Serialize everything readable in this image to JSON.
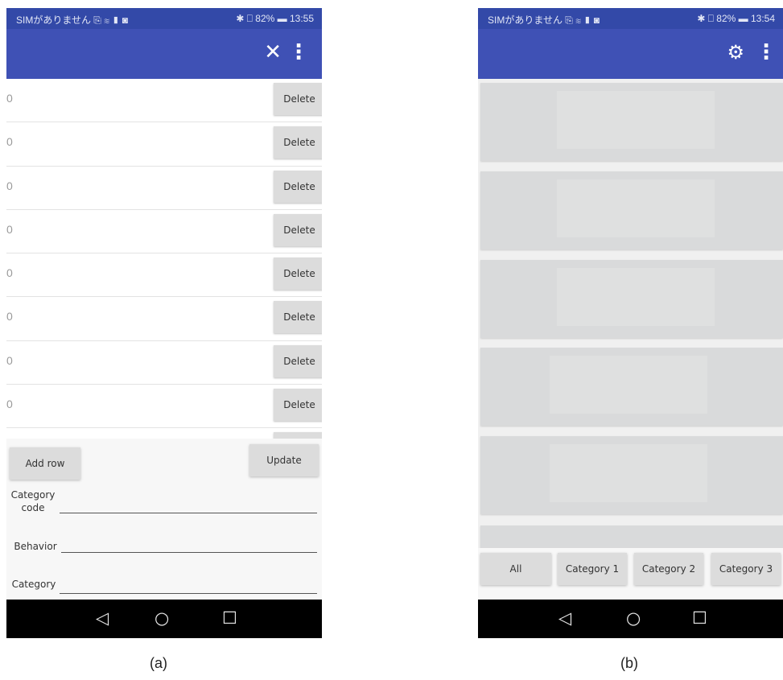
{
  "screen_a": {
    "status": {
      "left": "SIMがありません ⎘ ≋ ▮ ◙",
      "right": "✱ ⎕ 82% ▬ 13:55"
    },
    "appbar": {
      "close_icon": "close-icon",
      "more_icon": "more-vert-icon"
    },
    "rows": [
      {
        "value": "0",
        "delete_label": "Delete"
      },
      {
        "value": "0",
        "delete_label": "Delete"
      },
      {
        "value": "0",
        "delete_label": "Delete"
      },
      {
        "value": "0",
        "delete_label": "Delete"
      },
      {
        "value": "0",
        "delete_label": "Delete"
      },
      {
        "value": "0",
        "delete_label": "Delete"
      },
      {
        "value": "0",
        "delete_label": "Delete"
      },
      {
        "value": "0",
        "delete_label": "Delete"
      },
      {
        "value": "0",
        "delete_label": ""
      }
    ],
    "add_row_label": "Add row",
    "update_label": "Update",
    "fields": [
      {
        "label": "Category code",
        "value": ""
      },
      {
        "label": "Behavior",
        "value": ""
      },
      {
        "label": "Category",
        "value": ""
      }
    ]
  },
  "screen_b": {
    "status": {
      "left": "SIMがありません ⎘ ≋ ▮ ◙",
      "right": "✱ ⎕ 82% ▬ 13:54"
    },
    "appbar": {
      "settings_icon": "settings-icon",
      "more_icon": "more-vert-icon"
    },
    "categories": [
      "All",
      "Category 1",
      "Category 2",
      "Category 3"
    ]
  },
  "captions": {
    "a": "(a)",
    "b": "(b)"
  },
  "colors": {
    "statusbar": "#3349a8",
    "appbar": "#3f51b5",
    "button": "#dcdcdc",
    "navbar": "#000000"
  }
}
